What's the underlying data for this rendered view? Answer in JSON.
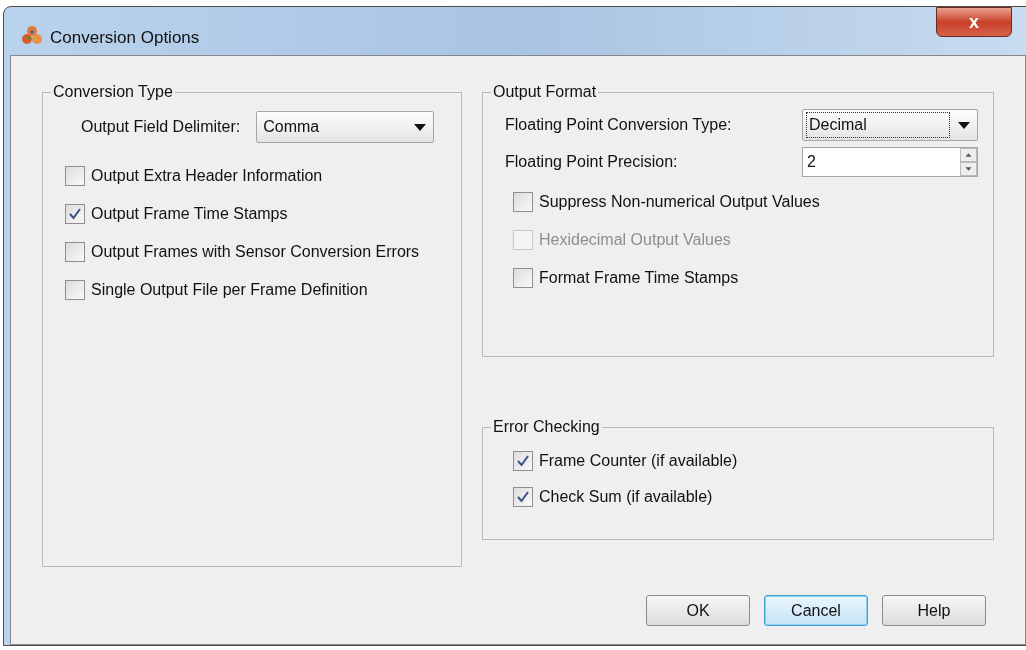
{
  "window": {
    "title": "Conversion Options",
    "close": "x"
  },
  "conversion_type": {
    "title": "Conversion Type",
    "delimiter_label": "Output Field Delimiter:",
    "delimiter_value": "Comma",
    "options": [
      {
        "label": "Output Extra Header Information",
        "checked": false
      },
      {
        "label": "Output Frame Time Stamps",
        "checked": true
      },
      {
        "label": "Output Frames with Sensor Conversion Errors",
        "checked": false
      },
      {
        "label": "Single Output File per Frame Definition",
        "checked": false
      }
    ]
  },
  "output_format": {
    "title": "Output Format",
    "fp_type_label": "Floating Point Conversion Type:",
    "fp_type_value": "Decimal",
    "fp_type_focused": true,
    "precision_label": "Floating Point Precision:",
    "precision_value": "2",
    "options": [
      {
        "label": "Suppress Non-numerical Output Values",
        "checked": false,
        "disabled": false
      },
      {
        "label": "Hexidecimal Output Values",
        "checked": false,
        "disabled": true
      },
      {
        "label": "Format Frame Time Stamps",
        "checked": false,
        "disabled": false
      }
    ]
  },
  "error_checking": {
    "title": "Error Checking",
    "options": [
      {
        "label": "Frame Counter (if available)",
        "checked": true
      },
      {
        "label": "Check Sum (if available)",
        "checked": true
      }
    ]
  },
  "buttons": [
    {
      "label": "OK",
      "default": false
    },
    {
      "label": "Cancel",
      "default": true
    },
    {
      "label": "Help",
      "default": false
    }
  ]
}
